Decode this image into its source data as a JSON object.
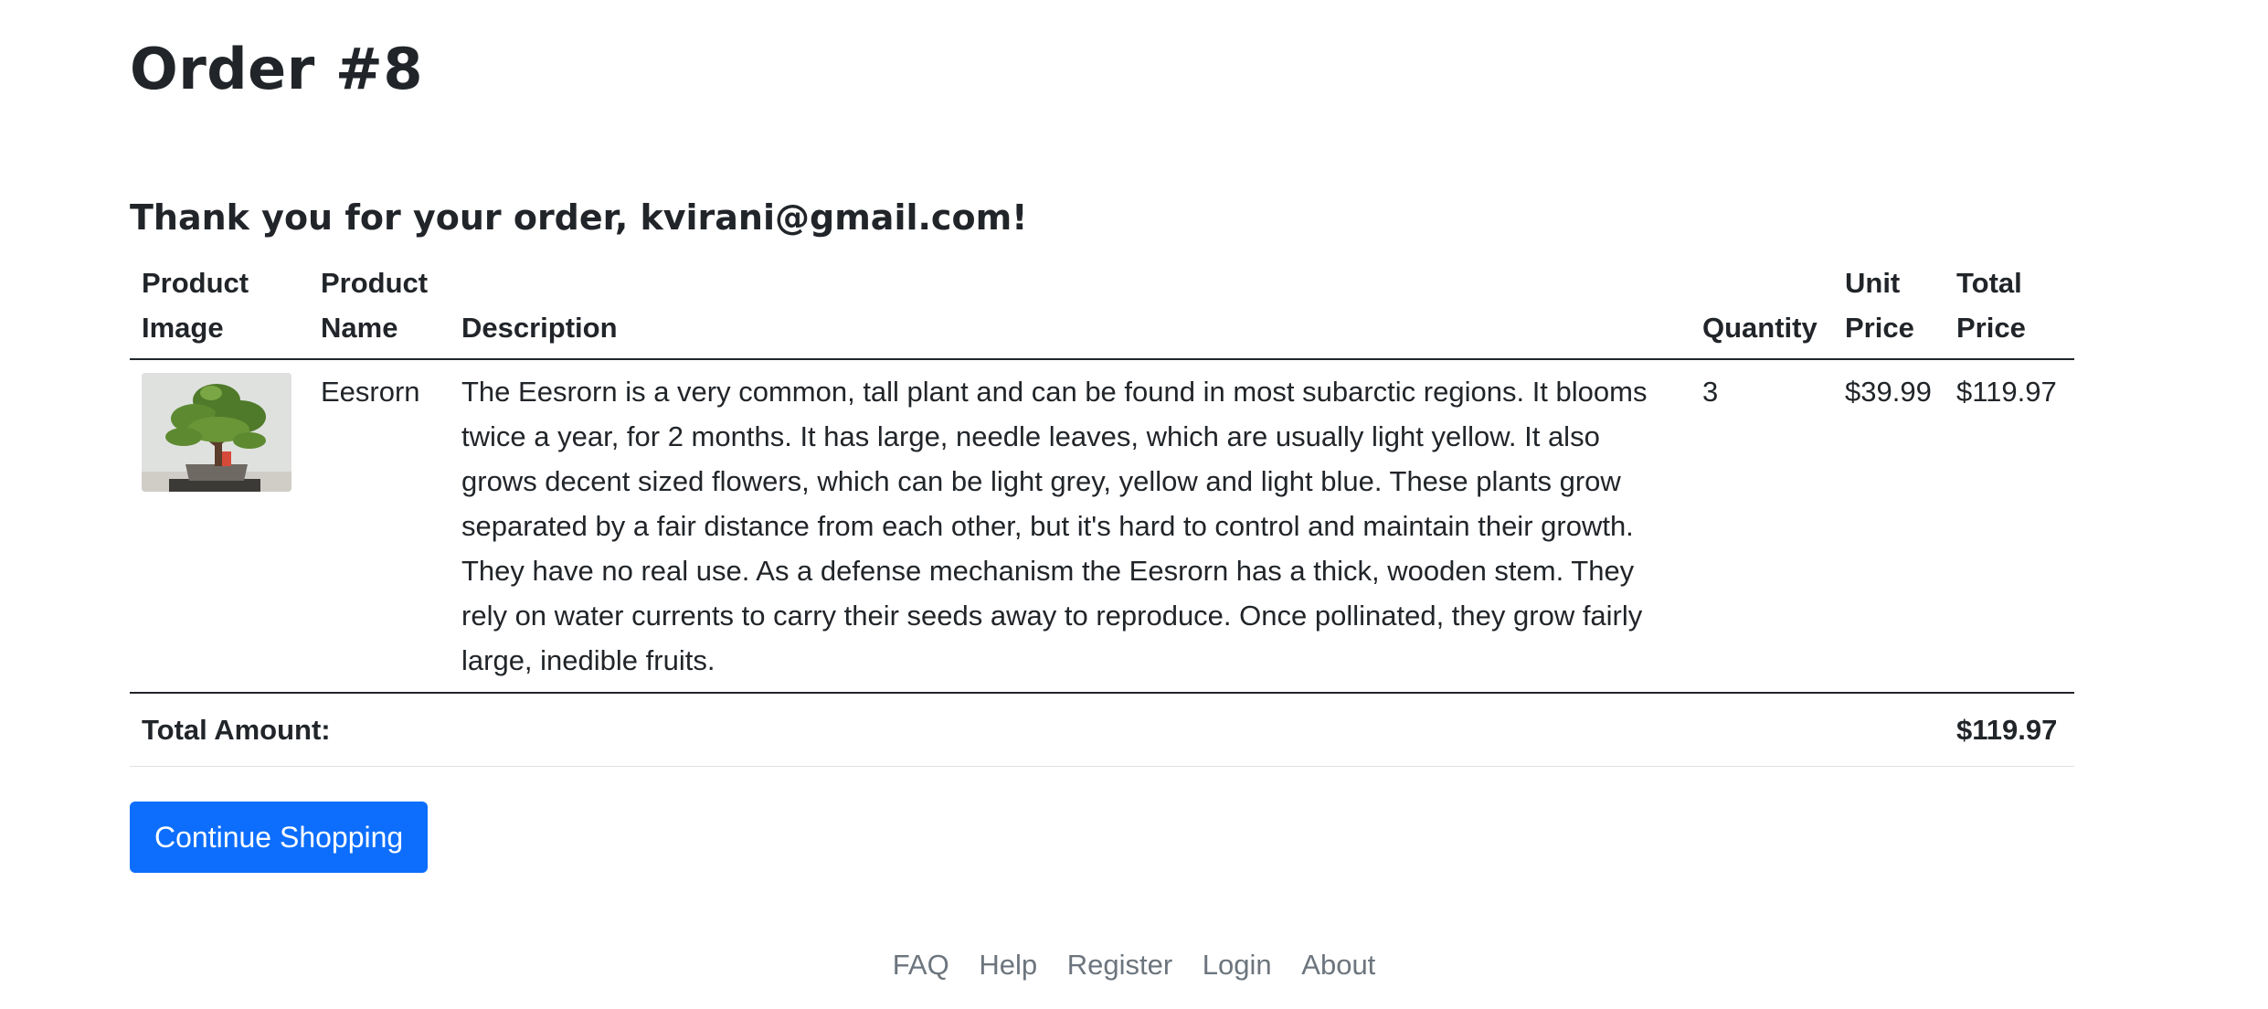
{
  "page": {
    "title": "Order #8",
    "thank_you": "Thank you for your order, kvirani@gmail.com!"
  },
  "table": {
    "headers": {
      "image": "Product Image",
      "name": "Product Name",
      "description": "Description",
      "quantity": "Quantity",
      "unit_price": "Unit Price",
      "total_price": "Total Price"
    },
    "rows": [
      {
        "image_icon": "bonsai-tree-image",
        "name": "Eesrorn",
        "description": "The Eesrorn is a very common, tall plant and can be found in most subarctic regions. It blooms twice a year, for 2 months. It has large, needle leaves, which are usually light yellow. It also grows decent sized flowers, which can be light grey, yellow and light blue. These plants grow separated by a fair distance from each other, but it's hard to control and maintain their growth. They have no real use. As a defense mechanism the Eesrorn has a thick, wooden stem. They rely on water currents to carry their seeds away to reproduce. Once pollinated, they grow fairly large, inedible fruits.",
        "quantity": "3",
        "unit_price": "$39.99",
        "total_price": "$119.97"
      }
    ],
    "footer": {
      "label": "Total Amount:",
      "amount": "$119.97"
    }
  },
  "actions": {
    "continue_label": "Continue Shopping"
  },
  "footer_nav": [
    "FAQ",
    "Help",
    "Register",
    "Login",
    "About"
  ],
  "colors": {
    "primary": "#0d6efd",
    "text": "#212529",
    "muted": "#6c757d"
  }
}
